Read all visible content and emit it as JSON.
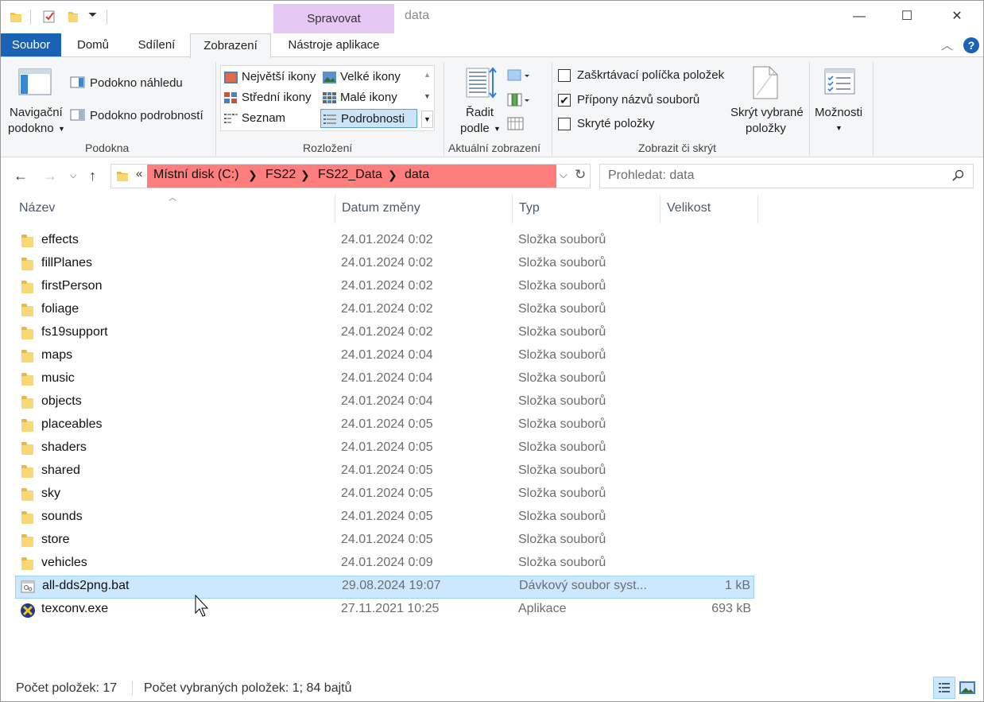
{
  "window": {
    "title": "data",
    "contextual_group": "Spravovat",
    "controls": {
      "minimize": "—",
      "maximize": "☐",
      "close": "✕"
    }
  },
  "tabs": [
    {
      "label": "Soubor"
    },
    {
      "label": "Domů"
    },
    {
      "label": "Sdílení"
    },
    {
      "label": "Zobrazení"
    },
    {
      "label": "Nástroje aplikace"
    }
  ],
  "ribbon": {
    "panes": {
      "group_label": "Podokna",
      "nav_pane_line1": "Navigační",
      "nav_pane_line2": "podokno",
      "preview_pane": "Podokno náhledu",
      "details_pane": "Podokno podrobností"
    },
    "layout": {
      "group_label": "Rozložení",
      "items": [
        "Největší ikony",
        "Velké ikony",
        "Střední ikony",
        "Malé ikony",
        "Seznam",
        "Podrobnosti"
      ],
      "selected": "Podrobnosti"
    },
    "current_view": {
      "group_label": "Aktuální zobrazení",
      "sort_line1": "Řadit",
      "sort_line2": "podle"
    },
    "show_hide": {
      "group_label": "Zobrazit či skrýt",
      "checkboxes": [
        {
          "label": "Zaškrtávací políčka položek",
          "checked": false
        },
        {
          "label": "Přípony názvů souborů",
          "checked": true
        },
        {
          "label": "Skryté položky",
          "checked": false
        }
      ],
      "hide_selected_line1": "Skrýt vybrané",
      "hide_selected_line2": "položky",
      "options": "Možnosti"
    }
  },
  "address": {
    "overflow": "«",
    "crumbs": [
      "Místní disk (C:)",
      "FS22",
      "FS22_Data",
      "data"
    ],
    "highlight_color": "#fe7e7e"
  },
  "search": {
    "placeholder": "Prohledat: data"
  },
  "columns": {
    "name": "Název",
    "date": "Datum změny",
    "type": "Typ",
    "size": "Velikost"
  },
  "files": [
    {
      "name": "effects",
      "date": "24.01.2024 0:02",
      "type": "Složka souborů",
      "size": "",
      "icon": "folder-icon"
    },
    {
      "name": "fillPlanes",
      "date": "24.01.2024 0:02",
      "type": "Složka souborů",
      "size": "",
      "icon": "folder-icon"
    },
    {
      "name": "firstPerson",
      "date": "24.01.2024 0:02",
      "type": "Složka souborů",
      "size": "",
      "icon": "folder-icon"
    },
    {
      "name": "foliage",
      "date": "24.01.2024 0:02",
      "type": "Složka souborů",
      "size": "",
      "icon": "folder-icon"
    },
    {
      "name": "fs19support",
      "date": "24.01.2024 0:02",
      "type": "Složka souborů",
      "size": "",
      "icon": "folder-icon"
    },
    {
      "name": "maps",
      "date": "24.01.2024 0:04",
      "type": "Složka souborů",
      "size": "",
      "icon": "folder-icon"
    },
    {
      "name": "music",
      "date": "24.01.2024 0:04",
      "type": "Složka souborů",
      "size": "",
      "icon": "folder-icon"
    },
    {
      "name": "objects",
      "date": "24.01.2024 0:04",
      "type": "Složka souborů",
      "size": "",
      "icon": "folder-icon"
    },
    {
      "name": "placeables",
      "date": "24.01.2024 0:05",
      "type": "Složka souborů",
      "size": "",
      "icon": "folder-icon"
    },
    {
      "name": "shaders",
      "date": "24.01.2024 0:05",
      "type": "Složka souborů",
      "size": "",
      "icon": "folder-icon"
    },
    {
      "name": "shared",
      "date": "24.01.2024 0:05",
      "type": "Složka souborů",
      "size": "",
      "icon": "folder-icon"
    },
    {
      "name": "sky",
      "date": "24.01.2024 0:05",
      "type": "Složka souborů",
      "size": "",
      "icon": "folder-icon"
    },
    {
      "name": "sounds",
      "date": "24.01.2024 0:05",
      "type": "Složka souborů",
      "size": "",
      "icon": "folder-icon"
    },
    {
      "name": "store",
      "date": "24.01.2024 0:05",
      "type": "Složka souborů",
      "size": "",
      "icon": "folder-icon"
    },
    {
      "name": "vehicles",
      "date": "24.01.2024 0:09",
      "type": "Složka souborů",
      "size": "",
      "icon": "folder-icon"
    },
    {
      "name": "all-dds2png.bat",
      "date": "29.08.2024 19:07",
      "type": "Dávkový soubor syst...",
      "size": "1 kB",
      "icon": "batch-file-icon",
      "selected": true
    },
    {
      "name": "texconv.exe",
      "date": "27.11.2021 10:25",
      "type": "Aplikace",
      "size": "693 kB",
      "icon": "application-icon"
    }
  ],
  "status": {
    "item_count": "Počet položek: 17",
    "selected": "Počet vybraných položek: 1; 84 bajtů"
  },
  "colors": {
    "file_tab": "#1a62b6",
    "context_tab": "#e6c8f5",
    "selection": "#cce8ff"
  }
}
